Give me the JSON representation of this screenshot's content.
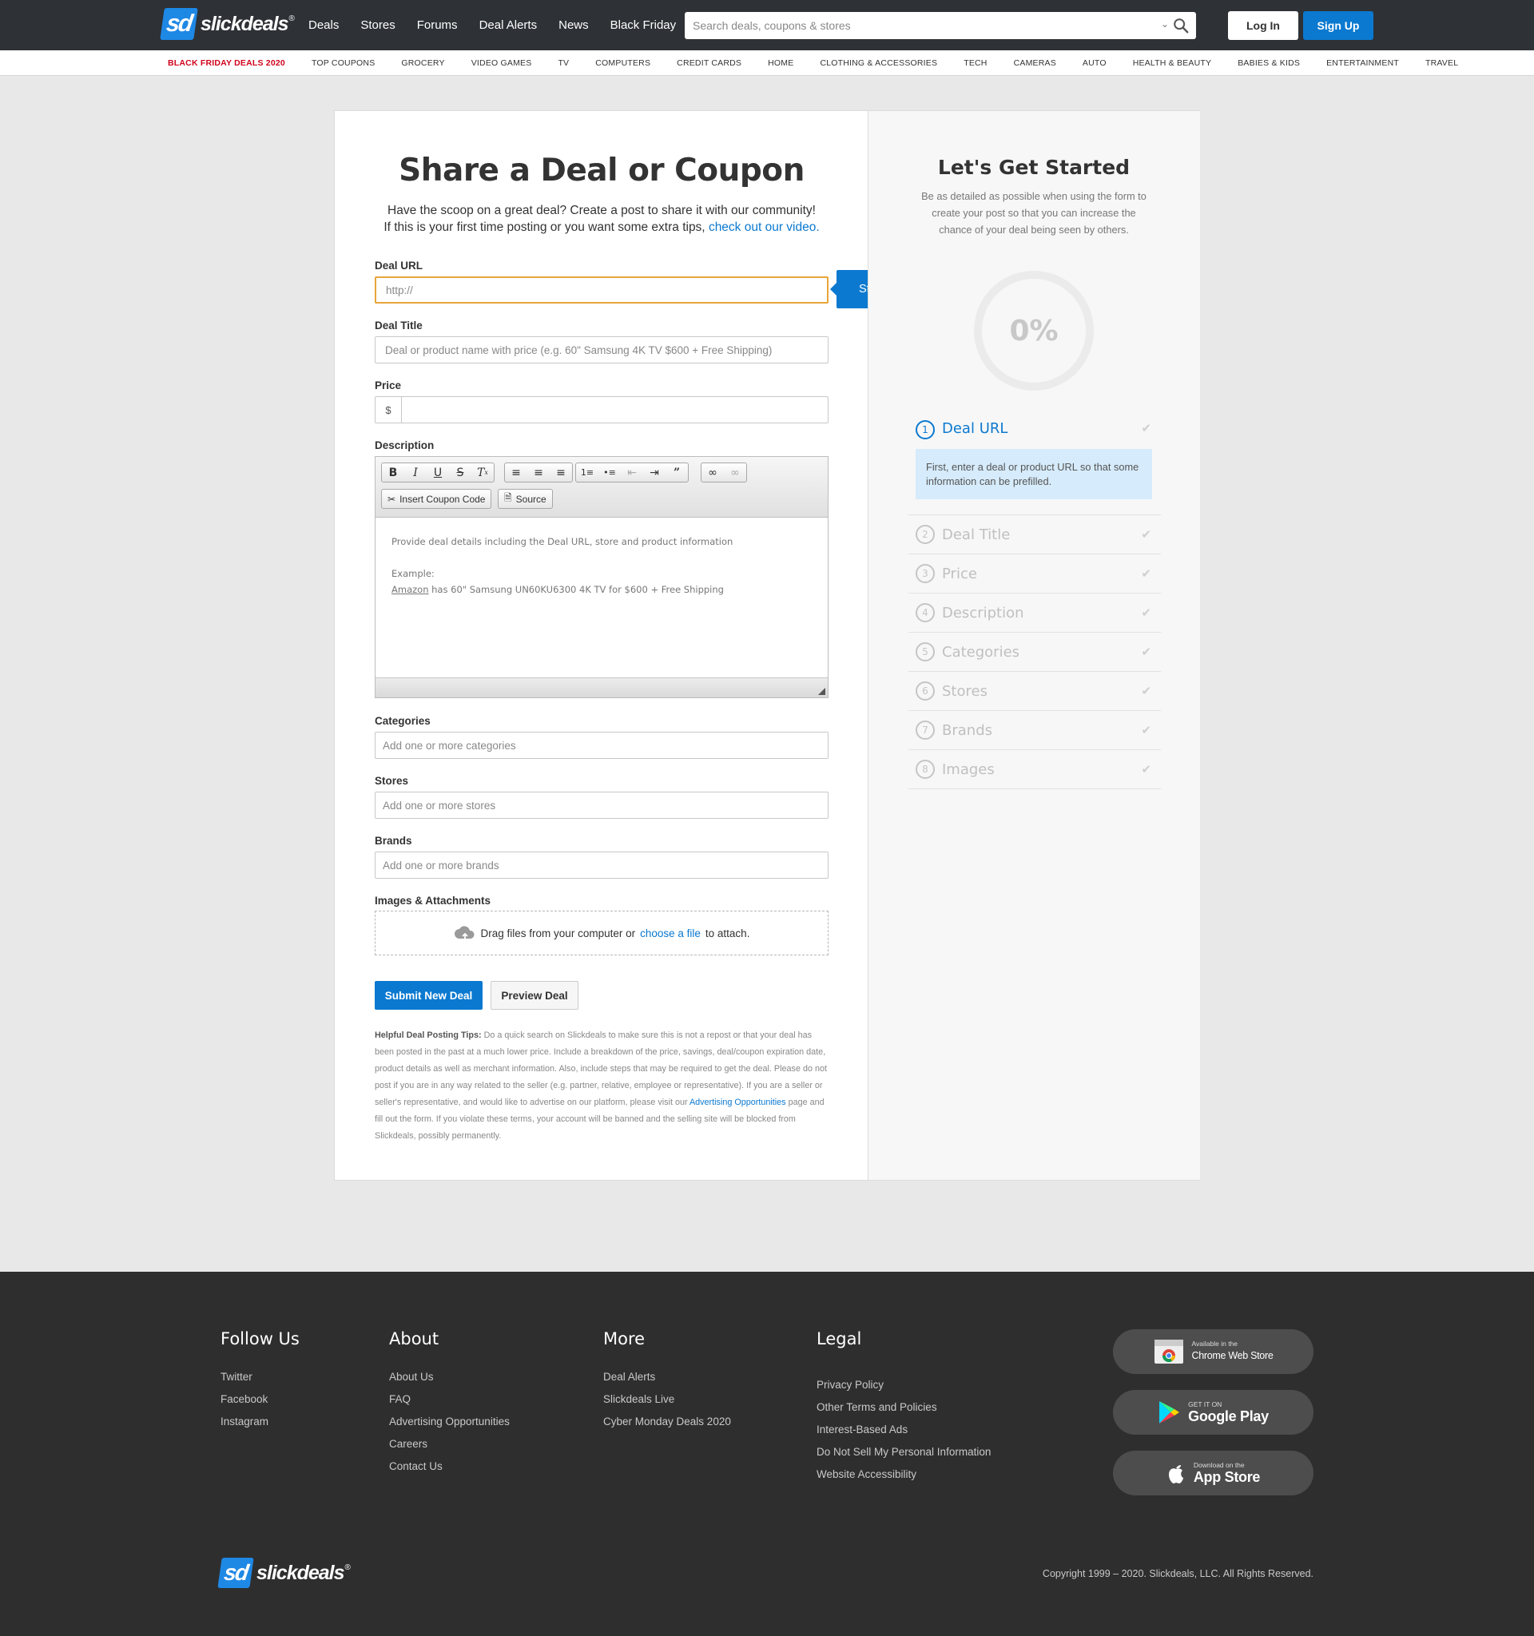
{
  "header": {
    "logo_mark": "sd",
    "logo_text": "slickdeals",
    "logo_reg": "®",
    "nav": [
      "Deals",
      "Stores",
      "Forums",
      "Deal Alerts",
      "News",
      "Black Friday"
    ],
    "search_placeholder": "Search deals, coupons & stores",
    "login": "Log In",
    "signup": "Sign Up"
  },
  "subnav": [
    "Black Friday Deals 2020",
    "Top Coupons",
    "Grocery",
    "Video Games",
    "TV",
    "Computers",
    "Credit Cards",
    "Home",
    "Clothing & Accessories",
    "Tech",
    "Cameras",
    "Auto",
    "Health & Beauty",
    "Babies & Kids",
    "Entertainment",
    "Travel"
  ],
  "form": {
    "title": "Share a Deal or Coupon",
    "intro_line1": "Have the scoop on a great deal? Create a post to share it with our community!",
    "intro_line2": "If this is your first time posting or you want some extra tips,",
    "intro_link": "check out our video.",
    "url_label": "Deal URL",
    "url_placeholder": "http://",
    "start_here": "Start Here!",
    "title_label": "Deal Title",
    "title_placeholder": "Deal or product name with price (e.g. 60\" Samsung 4K TV $600 + Free Shipping)",
    "price_label": "Price",
    "price_symbol": "$",
    "description_label": "Description",
    "insert_coupon": "Insert Coupon Code",
    "source": "Source",
    "editor_line1": "Provide deal details including the Deal URL, store and product information",
    "editor_example": "Example:",
    "editor_store": "Amazon",
    "editor_line3": " has 60\" Samsung UN60KU6300 4K TV for $600 + Free Shipping",
    "categories_label": "Categories",
    "categories_placeholder": "Add one or more categories",
    "stores_label": "Stores",
    "stores_placeholder": "Add one or more stores",
    "brands_label": "Brands",
    "brands_placeholder": "Add one or more brands",
    "images_label": "Images & Attachments",
    "drop_text": "Drag files from your computer or",
    "drop_link": "choose a file",
    "drop_after": "to attach.",
    "submit": "Submit New Deal",
    "preview": "Preview Deal",
    "tips_title": "Helpful Deal Posting Tips:",
    "tips_body": " Do a quick search on Slickdeals to make sure this is not a repost or that your deal has been posted in the past at a much lower price. Include a breakdown of the price, savings, deal/coupon expiration date, product details as well as merchant information. Also, include steps that may be required to get the deal. Please do not post if you are in any way related to the seller (e.g. partner, relative, employee or representative). If you are a seller or seller's representative, and would like to advertise on our platform, please visit our ",
    "tips_link": "Advertising Opportunities",
    "tips_end": " page and fill out the form. If you violate these terms, your account will be banned and the selling site will be blocked from Slickdeals, possibly permanently."
  },
  "side": {
    "title": "Let's Get Started",
    "desc": "Be as detailed as possible when using the form to create your post so that you can increase the chance of your deal being seen by others.",
    "progress": "0%",
    "progress_value": 0,
    "steps": [
      {
        "num": "1",
        "label": "Deal URL"
      },
      {
        "num": "2",
        "label": "Deal Title"
      },
      {
        "num": "3",
        "label": "Price"
      },
      {
        "num": "4",
        "label": "Description"
      },
      {
        "num": "5",
        "label": "Categories"
      },
      {
        "num": "6",
        "label": "Stores"
      },
      {
        "num": "7",
        "label": "Brands"
      },
      {
        "num": "8",
        "label": "Images"
      }
    ],
    "active_help": "First, enter a deal or product URL so that some information can be prefilled."
  },
  "footer": {
    "follow_title": "Follow Us",
    "follow": [
      "Twitter",
      "Facebook",
      "Instagram"
    ],
    "about_title": "About",
    "about": [
      "About Us",
      "FAQ",
      "Advertising Opportunities",
      "Careers",
      "Contact Us"
    ],
    "more_title": "More",
    "more": [
      "Deal Alerts",
      "Slickdeals Live",
      "Cyber Monday Deals 2020"
    ],
    "legal_title": "Legal",
    "legal": [
      "Privacy Policy",
      "Other Terms and Policies",
      "Interest-Based Ads",
      "Do Not Sell My Personal Information",
      "Website Accessibility"
    ],
    "chrome_small": "Available in the",
    "chrome_big": "Chrome Web Store",
    "play_small": "GET IT ON",
    "play_big": "Google Play",
    "apple_small": "Download on the",
    "apple_big": "App Store",
    "copyright": "Copyright 1999 – 2020. Slickdeals, LLC. All Rights Reserved."
  },
  "colors": {
    "brand_blue": "#0b79d0",
    "header_bg": "#2e3136",
    "footer_bg": "#2e2e2e",
    "focus_border": "#e8a53a",
    "hot_red": "#d0021b"
  }
}
